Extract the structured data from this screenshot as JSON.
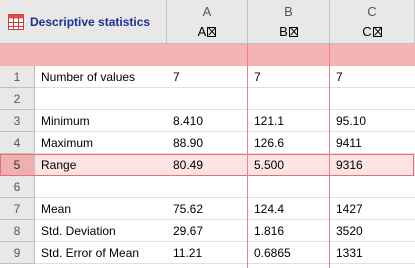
{
  "sheet": {
    "title": "Descriptive statistics",
    "columns": [
      {
        "letter": "A",
        "title": "A"
      },
      {
        "letter": "B",
        "title": "B"
      },
      {
        "letter": "C",
        "title": "C"
      }
    ],
    "rows": [
      {
        "num": "1",
        "label": "Number of values",
        "a": "7",
        "b": "7",
        "c": "7"
      },
      {
        "num": "2",
        "label": "",
        "a": "",
        "b": "",
        "c": ""
      },
      {
        "num": "3",
        "label": "Minimum",
        "a": "8.410",
        "b": "121.1",
        "c": "95.10"
      },
      {
        "num": "4",
        "label": "Maximum",
        "a": "88.90",
        "b": "126.6",
        "c": "9411"
      },
      {
        "num": "5",
        "label": "Range",
        "a": "80.49",
        "b": "5.500",
        "c": "9316"
      },
      {
        "num": "6",
        "label": "",
        "a": "",
        "b": "",
        "c": ""
      },
      {
        "num": "7",
        "label": "Mean",
        "a": "75.62",
        "b": "124.4",
        "c": "1427"
      },
      {
        "num": "8",
        "label": "Std. Deviation",
        "a": "29.67",
        "b": "1.816",
        "c": "3520"
      },
      {
        "num": "9",
        "label": "Std. Error of Mean",
        "a": "11.21",
        "b": "0.6865",
        "c": "1331"
      }
    ],
    "colors": {
      "accent": "#f08080",
      "header_bg": "#e8e8e8",
      "title_color": "#1f2f8f"
    }
  }
}
